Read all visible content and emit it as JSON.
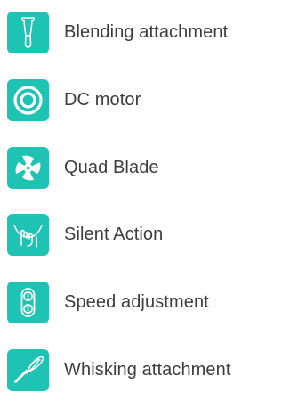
{
  "colors": {
    "accent": "#1ec3b3",
    "text": "#3d3d3d"
  },
  "features": [
    {
      "icon": "blender-icon",
      "label": "Blending attachment"
    },
    {
      "icon": "motor-icon",
      "label": "DC motor"
    },
    {
      "icon": "blade-icon",
      "label": "Quad Blade"
    },
    {
      "icon": "silent-action-icon",
      "label": "Silent Action"
    },
    {
      "icon": "speed-switch-icon",
      "label": "Speed adjustment"
    },
    {
      "icon": "whisk-icon",
      "label": "Whisking attachment"
    }
  ]
}
